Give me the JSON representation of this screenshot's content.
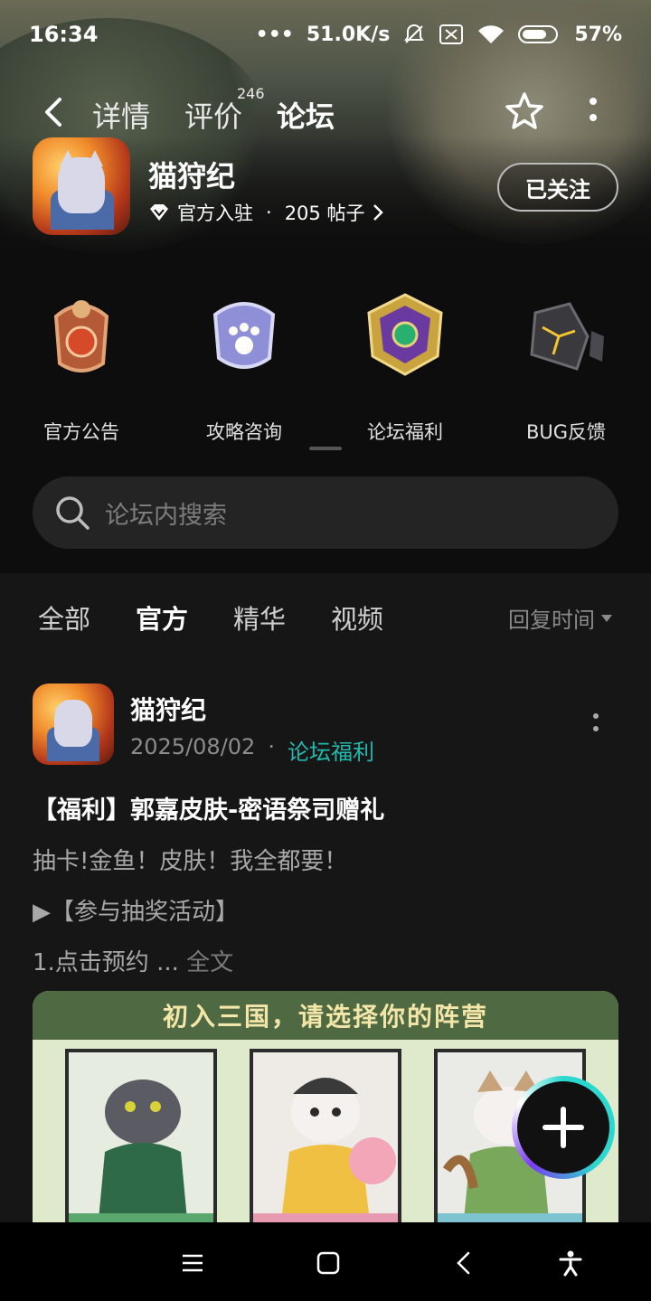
{
  "status_bar": {
    "time": "16:34",
    "net_speed": "51.0K/s",
    "battery": "57%"
  },
  "nav": {
    "tabs": [
      {
        "label": "详情"
      },
      {
        "label": "评价"
      },
      {
        "label": "论坛"
      }
    ],
    "review_count": "246",
    "active_tab": "论坛"
  },
  "app": {
    "name": "猫狩纪",
    "official": "官方入驻",
    "dot": "·",
    "posts": "205 帖子",
    "follow_label": "已关注"
  },
  "categories": [
    {
      "label": "官方公告",
      "icon": "announcement-badge-icon"
    },
    {
      "label": "攻略咨询",
      "icon": "paw-badge-icon"
    },
    {
      "label": "论坛福利",
      "icon": "gem-badge-icon"
    },
    {
      "label": "BUG反馈",
      "icon": "cracked-stone-icon"
    }
  ],
  "search": {
    "placeholder": "论坛内搜索"
  },
  "filter_tabs": [
    {
      "label": "全部"
    },
    {
      "label": "官方"
    },
    {
      "label": "精华"
    },
    {
      "label": "视频"
    }
  ],
  "active_filter": "官方",
  "sort_label": "回复时间",
  "post": {
    "author": "猫狩纪",
    "date": "2025/08/02",
    "dot": "·",
    "section": "论坛福利",
    "title": "【福利】郭嘉皮肤-密语祭司赠礼",
    "line1": "抽卡!金鱼！皮肤！我全都要！",
    "line2": "▶【参与抽奖活动】",
    "line3": "1.点击预约 ... ",
    "full_text": "全文",
    "image_header": "初入三国，请选择你的阵营"
  },
  "colors": {
    "accent": "#20c4b8",
    "background": "#0d0d0d",
    "card_bg": "#161616"
  }
}
